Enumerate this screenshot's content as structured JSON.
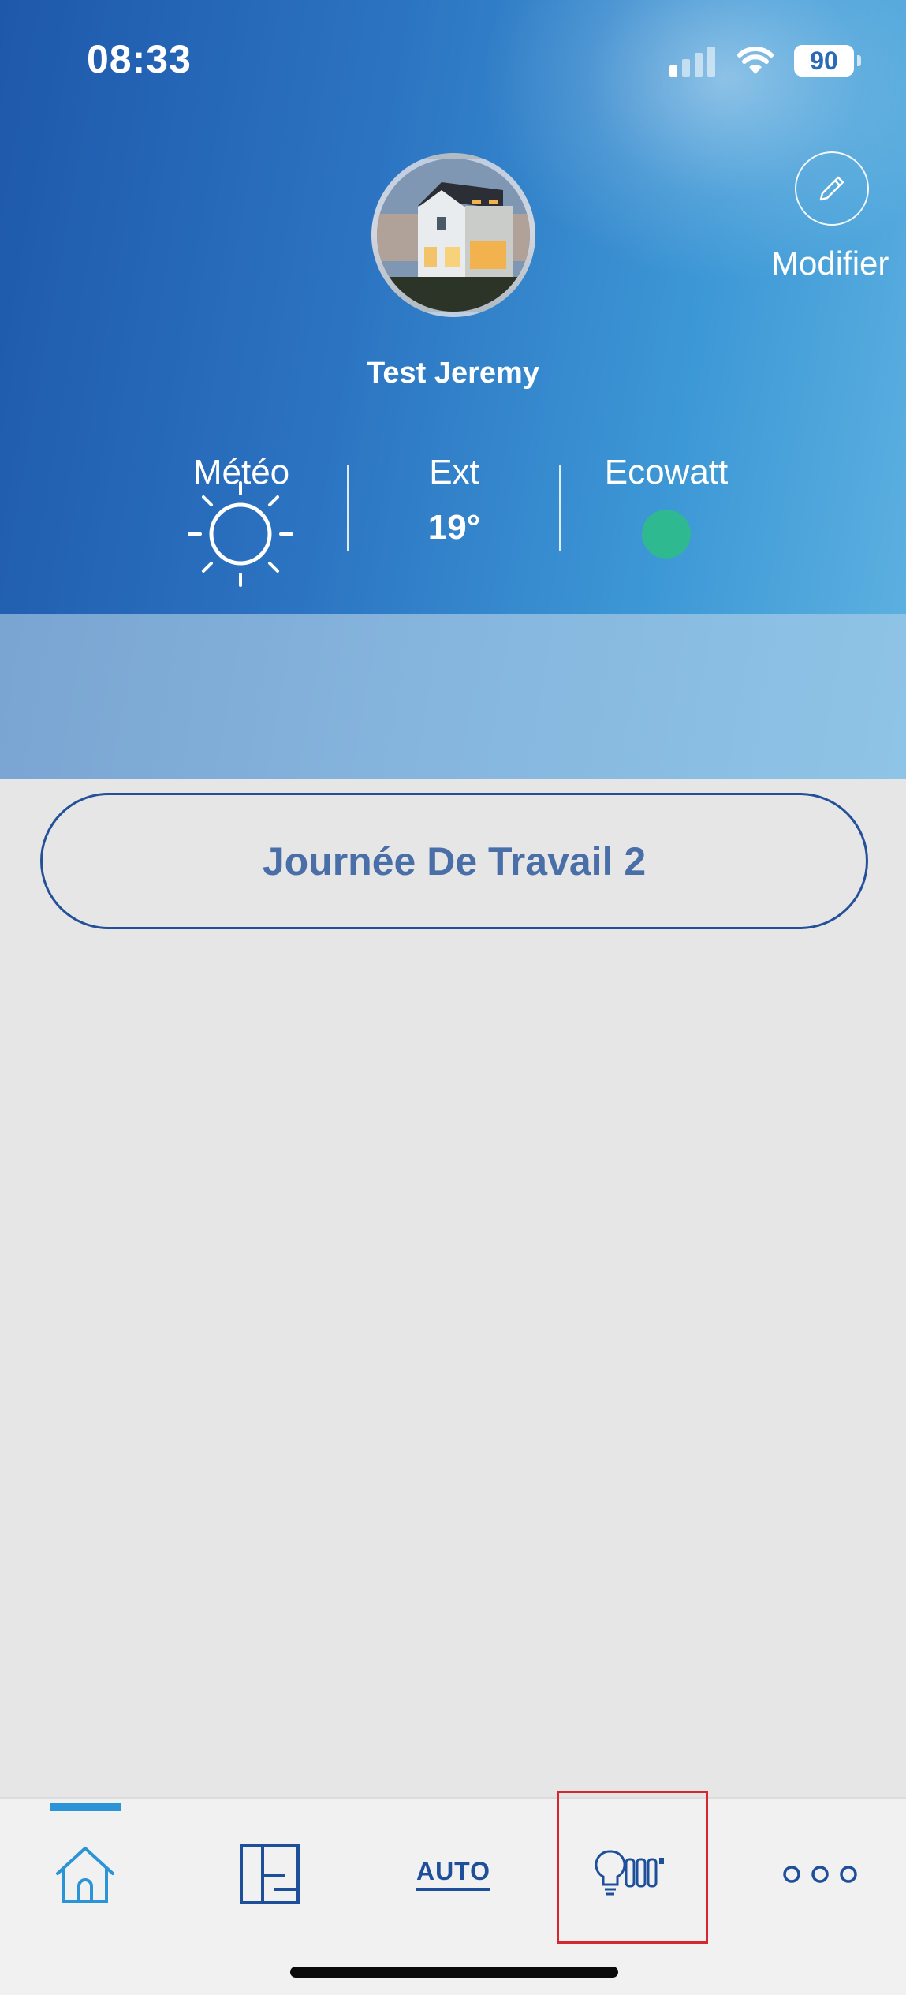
{
  "status_bar": {
    "time": "08:33",
    "battery": "90",
    "icons": [
      "cellular-signal-icon",
      "wifi-icon",
      "battery-icon"
    ]
  },
  "profile": {
    "name": "Test Jeremy",
    "edit_label": "Modifier"
  },
  "weather": {
    "meteo_label": "Météo",
    "meteo_icon": "sun-icon",
    "ext_label": "Ext",
    "ext_value": "19°",
    "ecowatt_label": "Ecowatt",
    "ecowatt_color": "#2fb991"
  },
  "scenario": {
    "label": "Journée De Travail 2"
  },
  "nav": {
    "items": [
      {
        "id": "home",
        "icon": "home-icon",
        "active": true
      },
      {
        "id": "floorplan",
        "icon": "floorplan-icon"
      },
      {
        "id": "auto",
        "label": "AUTO"
      },
      {
        "id": "devices",
        "icon": "lightbulb-radiator-icon",
        "highlighted": true
      },
      {
        "id": "more",
        "icon": "more-dots-icon"
      }
    ]
  },
  "colors": {
    "header_start": "#1e58aa",
    "header_end": "#5cb0e0",
    "nav_blue": "#1e4f9a",
    "active_blue": "#2a94d6",
    "highlight_red": "#d7262e"
  }
}
